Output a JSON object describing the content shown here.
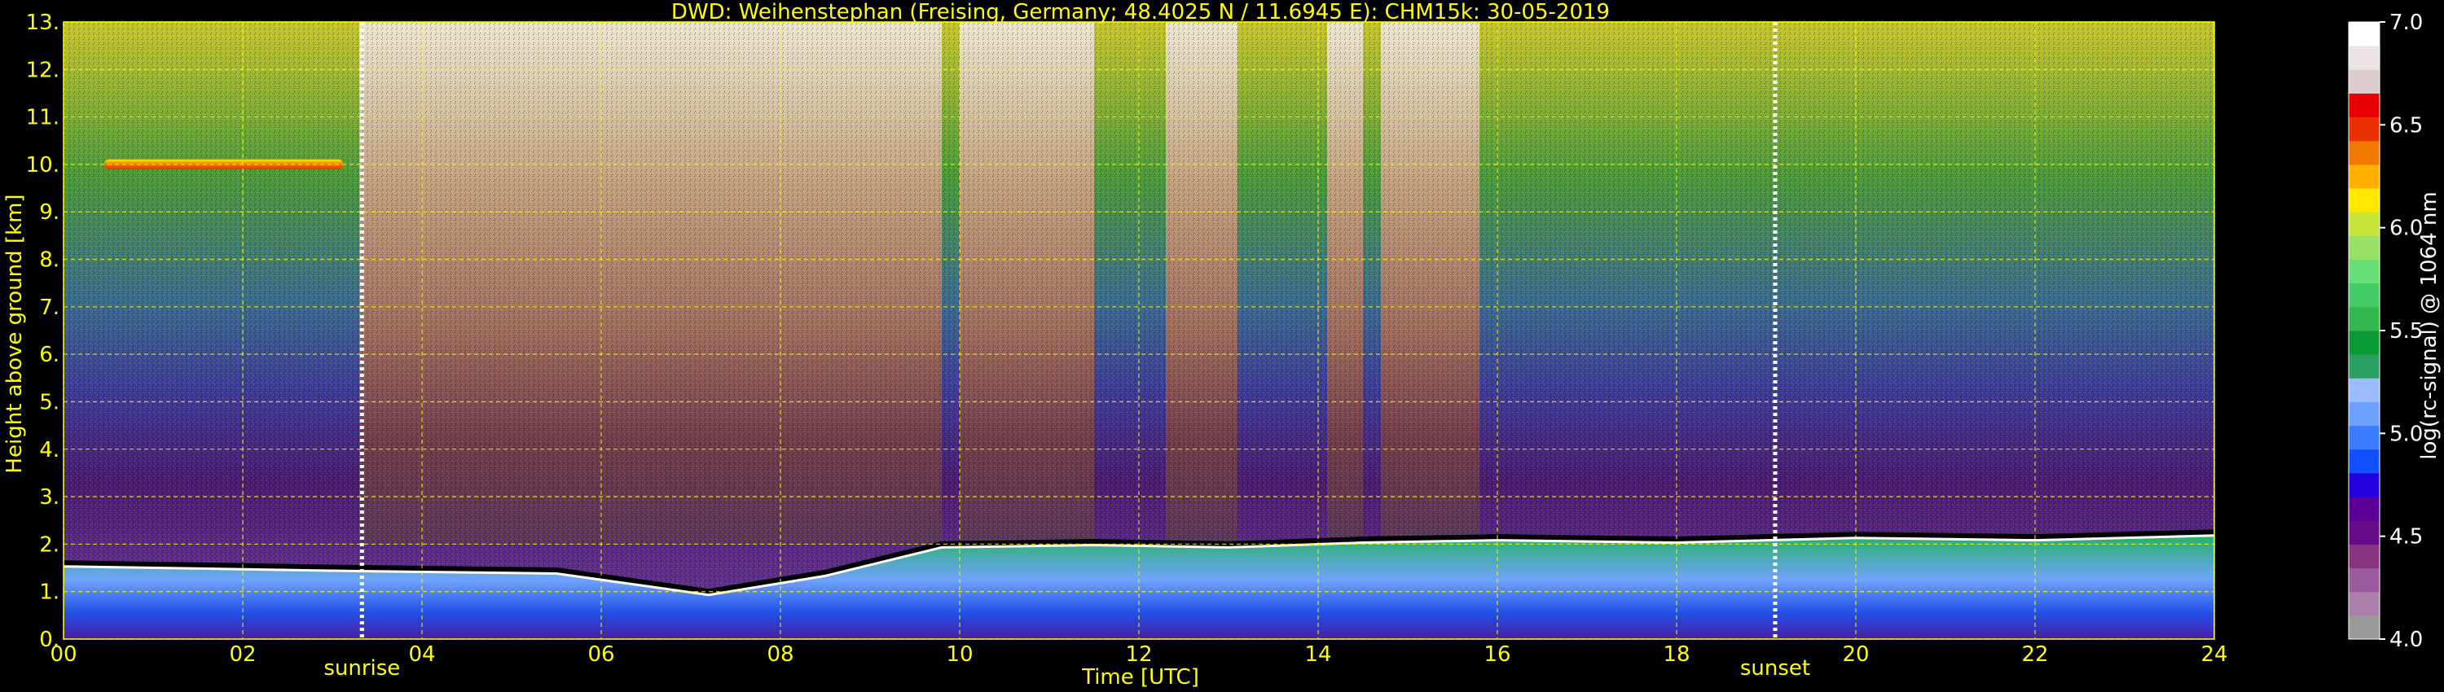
{
  "chart_data": {
    "type": "heatmap",
    "title": "DWD: Weihenstephan (Freising, Germany; 48.4025 N / 11.6945 E):    CHM15k: 30-05-2019",
    "xlabel": "Time [UTC]",
    "ylabel": "Height above ground [km]",
    "xlim": [
      0,
      24
    ],
    "ylim": [
      0,
      13
    ],
    "x_ticks": [
      "00",
      "02",
      "04",
      "06",
      "08",
      "10",
      "12",
      "14",
      "16",
      "18",
      "20",
      "22",
      "24"
    ],
    "y_ticks": [
      "0.",
      "1.",
      "2.",
      "3.",
      "4.",
      "5.",
      "6.",
      "7.",
      "8.",
      "9.",
      "10.",
      "11.",
      "12.",
      "13."
    ],
    "grid": true,
    "annotations": [
      {
        "label": "sunrise",
        "x": 3.33
      },
      {
        "label": "sunset",
        "x": 19.1
      }
    ],
    "colorbar": {
      "label": "log(rc-signal) @ 1064 nm",
      "range": [
        4.0,
        7.0
      ],
      "ticks": [
        "4.0",
        "4.5",
        "5.0",
        "5.5",
        "6.0",
        "6.5",
        "7.0"
      ],
      "colors": [
        "#9a9a9a",
        "#a97fa9",
        "#9b5a9b",
        "#86347f",
        "#650a88",
        "#5a0099",
        "#2200e0",
        "#1050ff",
        "#3a7bff",
        "#6ea0ff",
        "#9cbcff",
        "#2aa060",
        "#0a9a36",
        "#33b850",
        "#44cc66",
        "#66dd77",
        "#99e066",
        "#c8e63a",
        "#ffe800",
        "#ffb000",
        "#f07800",
        "#e83000",
        "#e80000",
        "#dccdcc",
        "#ece4e4",
        "#ffffff"
      ]
    },
    "features": {
      "boundary_layer_top_km": [
        [
          0,
          1.6
        ],
        [
          3.3,
          1.5
        ],
        [
          5.5,
          1.45
        ],
        [
          7.2,
          1.0
        ],
        [
          8.5,
          1.4
        ],
        [
          9.8,
          2.0
        ],
        [
          11.5,
          2.05
        ],
        [
          13.0,
          2.0
        ],
        [
          14.5,
          2.1
        ],
        [
          16.0,
          2.15
        ],
        [
          18.0,
          2.1
        ],
        [
          20.0,
          2.2
        ],
        [
          22.0,
          2.15
        ],
        [
          24.0,
          2.25
        ]
      ],
      "high_cloud_km": [
        {
          "x_start": 0.0,
          "x_end": 3.3,
          "height": 10.0
        }
      ],
      "bright_signal_periods": [
        [
          3.3,
          7.2
        ],
        [
          7.2,
          9.8
        ],
        [
          10.0,
          11.5
        ],
        [
          12.3,
          13.1
        ],
        [
          14.1,
          14.5
        ],
        [
          14.7,
          15.8
        ]
      ]
    }
  }
}
